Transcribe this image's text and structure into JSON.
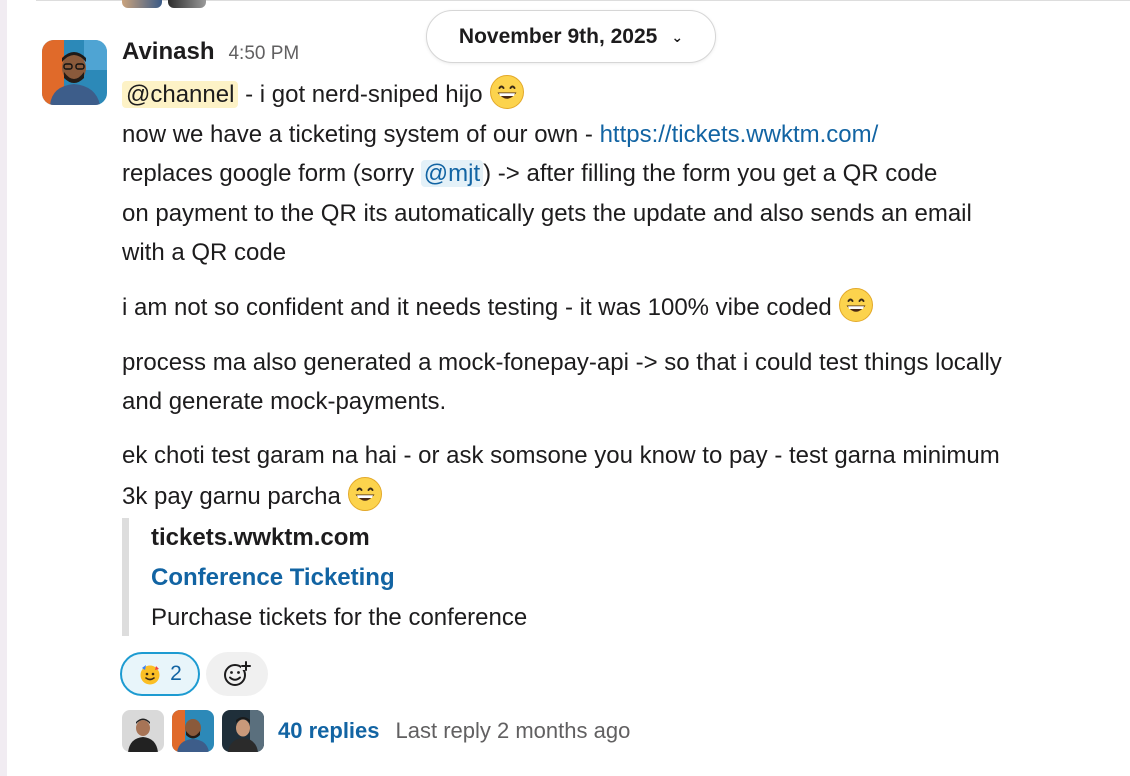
{
  "date_divider": {
    "label": "November 9th, 2025"
  },
  "message": {
    "author": "Avinash",
    "time": "4:50 PM",
    "line1": {
      "mention": "@channel",
      "text": " - i got nerd-sniped hijo"
    },
    "line2": {
      "text": "now we have a ticketing system of our own - ",
      "link": "https://tickets.wwktm.com/"
    },
    "line3": {
      "before": "replaces google form (sorry ",
      "mention": "@mjt",
      "after": ") -> after filling the form you get a QR code"
    },
    "line4": "on payment to the QR its automatically gets the update and also sends an email",
    "line5": "with a QR code",
    "para2": "i am not so confident and it needs testing - it was 100% vibe coded",
    "para3_line1": "process ma also generated a mock-fonepay-api -> so that i could test things locally",
    "para3_line2": "and generate mock-payments.",
    "para4_line1": "ek choti test garam na hai - or ask somsone you know to pay - test garna minimum",
    "para4_line2": "3k pay garnu parcha",
    "emoji_icon": "grinning-face-icon"
  },
  "unfurl": {
    "site": "tickets.wwktm.com",
    "title": "Conference Ticketing",
    "description": "Purchase tickets for the conference"
  },
  "reactions": [
    {
      "emoji": "party-face-icon",
      "count": "2"
    }
  ],
  "add_reaction_icon": "add-reaction-icon",
  "thread": {
    "replies": "40 replies",
    "last_reply": "Last reply 2 months ago"
  },
  "colors": {
    "link": "#1264a3",
    "mention_channel_bg": "#fdf2c6",
    "mention_user_bg": "#e4f1f8",
    "reaction_border": "#1d9bd1"
  }
}
